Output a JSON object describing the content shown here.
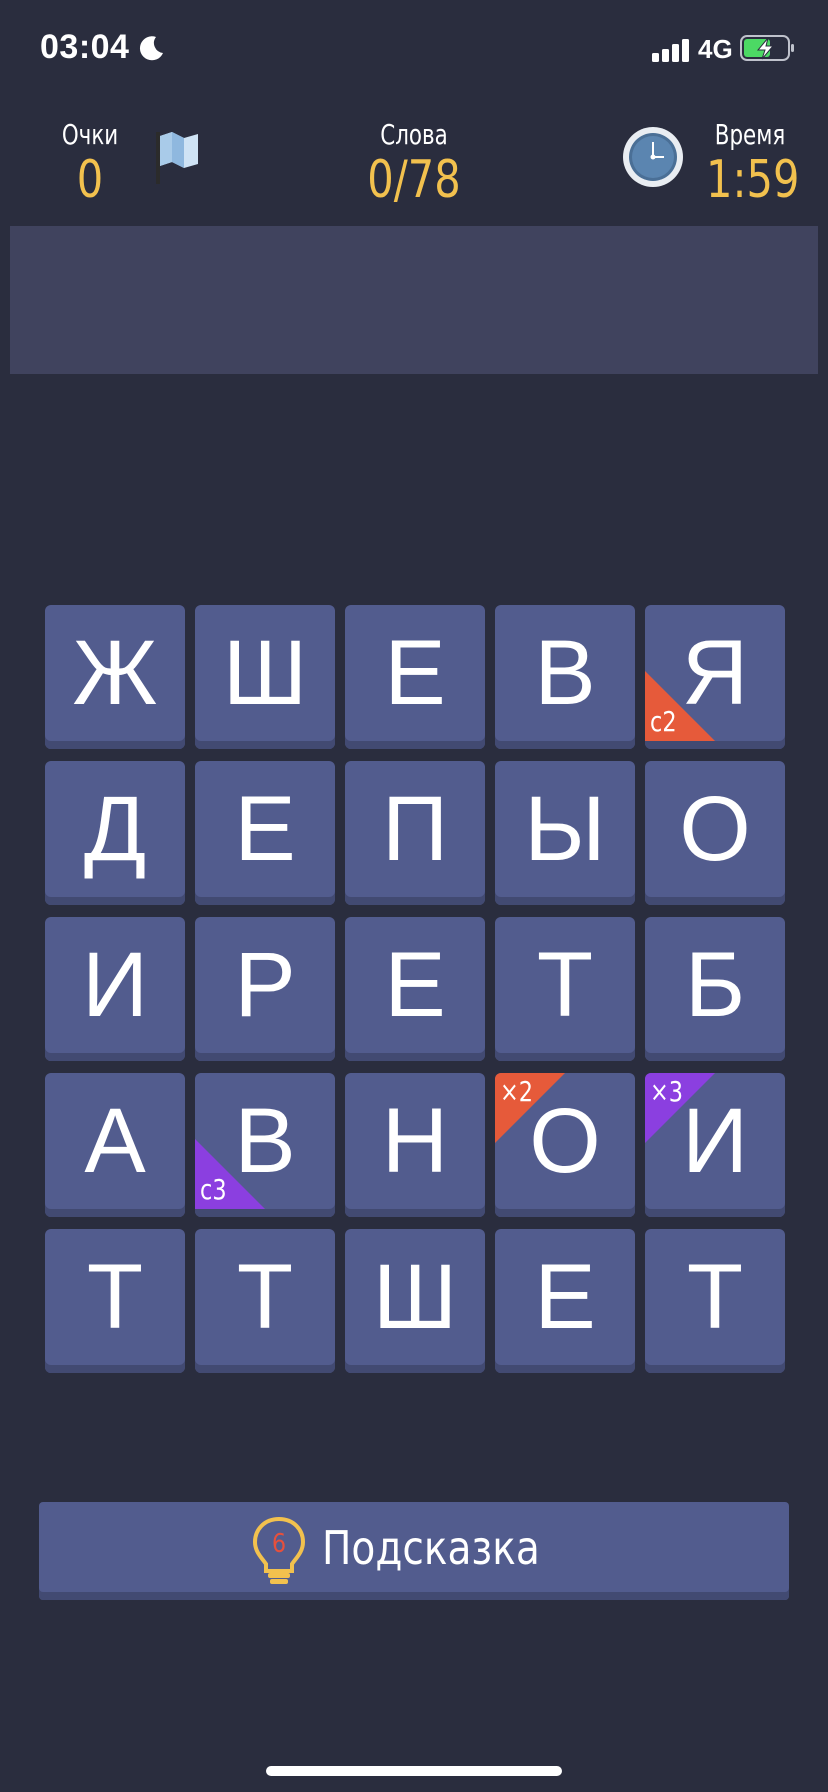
{
  "status_bar": {
    "time": "03:04",
    "network": "4G",
    "moon_icon": "moon-icon",
    "signal_icon": "signal-bars-icon",
    "battery_icon": "battery-charging-icon"
  },
  "header": {
    "score_label": "Очки",
    "score_value": "0",
    "words_label": "Слова",
    "words_value": "0/78",
    "time_label": "Время",
    "time_value": "1:59",
    "flag_icon": "flag-icon",
    "clock_icon": "clock-icon"
  },
  "colors": {
    "background": "#2a2d3e",
    "tile": "#525c8e",
    "value_yellow": "#f2c14e",
    "badge_orange": "#e65a3a",
    "badge_purple": "#8b3fe0"
  },
  "grid": {
    "rows": [
      [
        {
          "letter": "Ж"
        },
        {
          "letter": "Ш"
        },
        {
          "letter": "Е"
        },
        {
          "letter": "В"
        },
        {
          "letter": "Я",
          "badge": "с2",
          "badge_color": "orange",
          "badge_pos": "bottom-left"
        }
      ],
      [
        {
          "letter": "Д"
        },
        {
          "letter": "Е"
        },
        {
          "letter": "П"
        },
        {
          "letter": "Ы"
        },
        {
          "letter": "О"
        }
      ],
      [
        {
          "letter": "И"
        },
        {
          "letter": "Р"
        },
        {
          "letter": "Е"
        },
        {
          "letter": "Т"
        },
        {
          "letter": "Б"
        }
      ],
      [
        {
          "letter": "А"
        },
        {
          "letter": "В",
          "badge": "с3",
          "badge_color": "purple",
          "badge_pos": "bottom-left"
        },
        {
          "letter": "Н"
        },
        {
          "letter": "О",
          "badge": "×2",
          "badge_color": "orange",
          "badge_pos": "top-left"
        },
        {
          "letter": "И",
          "badge": "×3",
          "badge_color": "purple",
          "badge_pos": "top-left"
        }
      ],
      [
        {
          "letter": "Т"
        },
        {
          "letter": "Т"
        },
        {
          "letter": "Ш"
        },
        {
          "letter": "Е"
        },
        {
          "letter": "Т"
        }
      ]
    ]
  },
  "hint": {
    "label": "Подсказка",
    "count": "6",
    "icon": "lightbulb-icon"
  }
}
